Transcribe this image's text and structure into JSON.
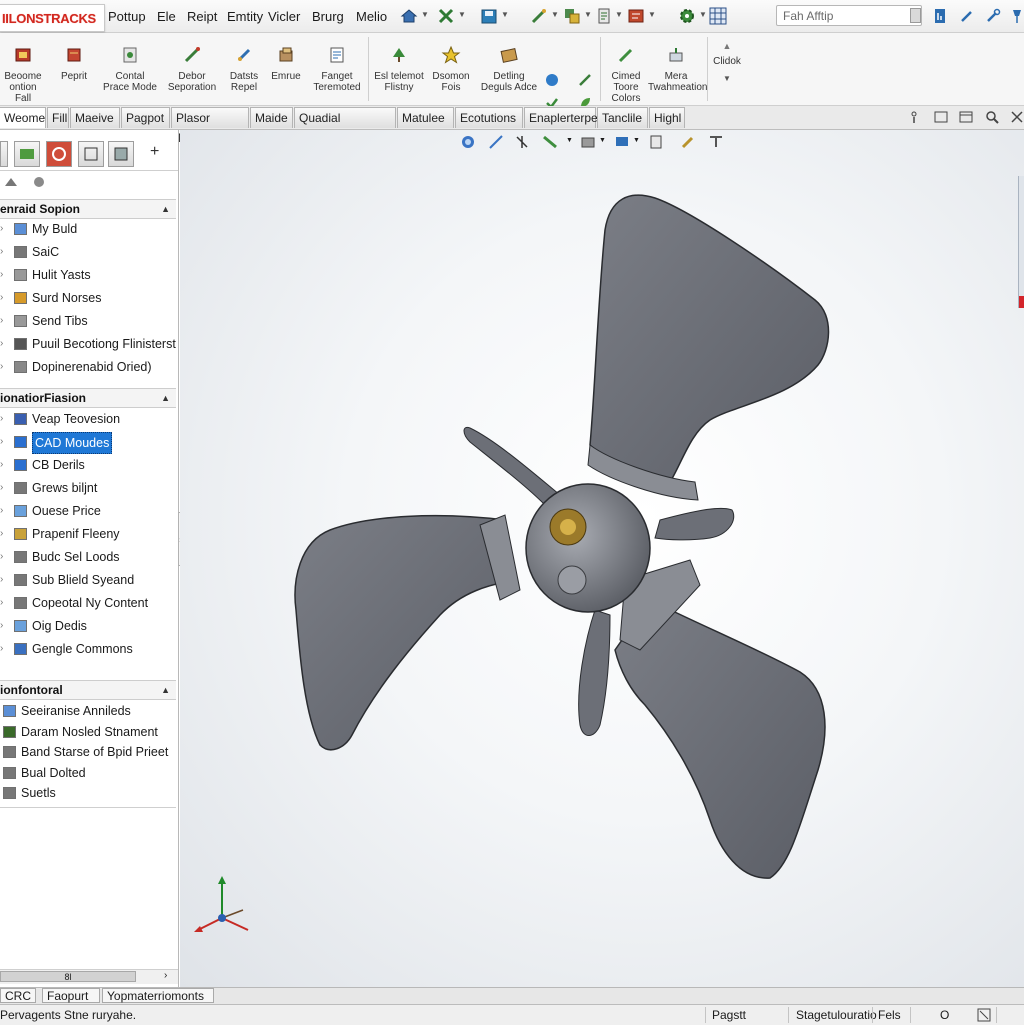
{
  "app": {
    "logo_text": "IILONSTRACKS",
    "menu": [
      "Pottup",
      "Ele",
      "Reipt",
      "Emtity",
      "Vicler",
      "Brurg",
      "Melio"
    ],
    "search_placeholder": "Fah Afftip"
  },
  "command_manager": {
    "buttons": [
      {
        "label": "Beoome\nontion Fall"
      },
      {
        "label": "Peprit"
      },
      {
        "label": "Contal\nPrace Mode"
      },
      {
        "label": "Debor\nSeporation"
      },
      {
        "label": "Datsts\nRepel"
      },
      {
        "label": "Emrue"
      },
      {
        "label": "Fanget\nTeremoted"
      },
      {
        "label": "Esl telemot\nFlistny"
      },
      {
        "label": "Dsomon\nFois"
      },
      {
        "label": "Detling\nDeguls Adce"
      },
      {
        "label": "Cimed\nToore\nColors"
      },
      {
        "label": "Mera\nTwahmeation"
      },
      {
        "label": "Clidok"
      }
    ]
  },
  "tabs": [
    "Weome",
    "Fill",
    "Maeive",
    "Pagpot",
    "Plasor Tepete",
    "Maide",
    "Quadial Seotoune",
    "Matulee",
    "Ecotutions",
    "Enaplerterpet",
    "Tanclile",
    "Highl"
  ],
  "panel": {
    "sections": [
      {
        "title": "enraid Sopion",
        "items": [
          "My Buld",
          "SaiC",
          "Hulit Yasts",
          "Surd Norses",
          "Send Tibs",
          "Puuil Becotiong Flinisterst",
          "Dopinerenabid Oried)"
        ]
      },
      {
        "title": "ionatiorFiasion",
        "items": [
          "Veap Teovesion",
          "CAD Moudes",
          "CB Derils",
          "Grews biljnt",
          "Ouese Price",
          "Prapenif Fleeny",
          "Budc Sel Loods",
          "Sub Blield Syeand",
          "Copeotal Ny Content",
          "Oig Dedis",
          "Gengle Commons"
        ]
      },
      {
        "title": "ionfontoral",
        "items": [
          "Seeiranise Annileds",
          "Daram Nosled Stnament",
          "Band Starse of Bpid Prieet",
          "Bual Dolted",
          "Suetls"
        ]
      }
    ],
    "selected_item": "CAD Moudes",
    "scroll_label": "8l"
  },
  "model_tabs": [
    "CRC",
    "Faopurt",
    "Yopmaterriomonts"
  ],
  "status": {
    "message": "Pervagents Stne ruryahe.",
    "fields": [
      "Pagstt",
      "Stagetulouratio",
      "Fels",
      "O"
    ]
  },
  "colors": {
    "blade": "#6f7178",
    "selection": "#1f78d6",
    "brand_red": "#d2281f"
  }
}
